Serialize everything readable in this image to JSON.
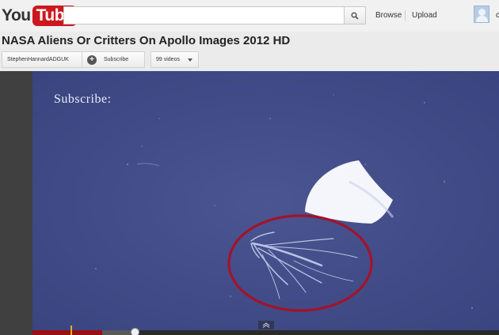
{
  "logo": {
    "you": "You",
    "tube": "Tube"
  },
  "search": {
    "placeholder": "",
    "value": ""
  },
  "nav": {
    "browse": "Browse",
    "upload": "Upload",
    "user_initial": "c"
  },
  "video": {
    "title": "NASA Aliens Or Critters On Apollo Images 2012 HD",
    "channel": "StephenHannardADGUK",
    "subscribe_label": "Subscribe",
    "subscribe_icon": "+",
    "videos_label": "99 videos",
    "overlay_text": "Subscribe:",
    "progress_played_fraction": 0.15,
    "progress_loaded_fraction": 0.22
  },
  "colors": {
    "brand_red": "#cc181e",
    "player_bg": "#3f4a86",
    "annotation_circle": "#a3132a",
    "progress_red": "#9b0e12"
  },
  "icons": [
    "search-icon",
    "plus-icon",
    "chevron-down-icon",
    "avatar-icon",
    "expand-up-icon"
  ]
}
